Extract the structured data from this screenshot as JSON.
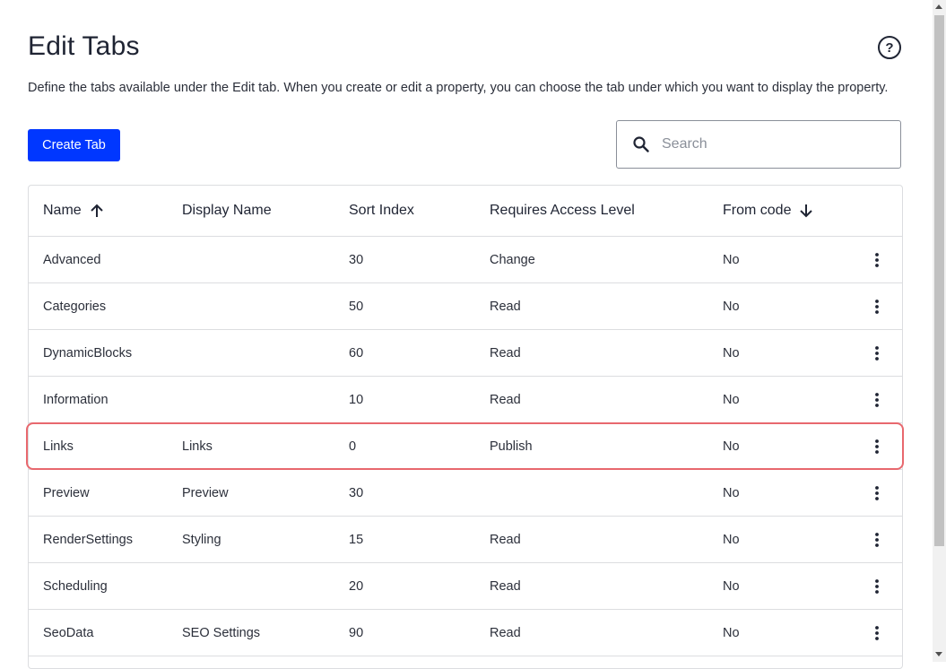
{
  "header": {
    "title": "Edit Tabs",
    "help_icon": "question-circle-icon",
    "description": "Define the tabs available under the Edit tab. When you create or edit a property, you can choose the tab under which you want to display the property."
  },
  "toolbar": {
    "create_label": "Create Tab",
    "search_placeholder": "Search",
    "search_value": ""
  },
  "table": {
    "columns": {
      "name": "Name",
      "display_name": "Display Name",
      "sort_index": "Sort Index",
      "access_level": "Requires Access Level",
      "from_code": "From code"
    },
    "sort": {
      "name": "ascending",
      "from_code": "descending"
    },
    "rows": [
      {
        "name": "Advanced",
        "display_name": "",
        "sort_index": "30",
        "access_level": "Change",
        "from_code": "No"
      },
      {
        "name": "Categories",
        "display_name": "",
        "sort_index": "50",
        "access_level": "Read",
        "from_code": "No"
      },
      {
        "name": "DynamicBlocks",
        "display_name": "",
        "sort_index": "60",
        "access_level": "Read",
        "from_code": "No"
      },
      {
        "name": "Information",
        "display_name": "",
        "sort_index": "10",
        "access_level": "Read",
        "from_code": "No"
      },
      {
        "name": "Links",
        "display_name": "Links",
        "sort_index": "0",
        "access_level": "Publish",
        "from_code": "No",
        "highlighted": true
      },
      {
        "name": "Preview",
        "display_name": "Preview",
        "sort_index": "30",
        "access_level": "",
        "from_code": "No"
      },
      {
        "name": "RenderSettings",
        "display_name": "Styling",
        "sort_index": "15",
        "access_level": "Read",
        "from_code": "No"
      },
      {
        "name": "Scheduling",
        "display_name": "",
        "sort_index": "20",
        "access_level": "Read",
        "from_code": "No"
      },
      {
        "name": "SeoData",
        "display_name": "SEO Settings",
        "sort_index": "90",
        "access_level": "Read",
        "from_code": "No"
      }
    ]
  },
  "colors": {
    "primary": "#0037ff",
    "highlight": "#e8686e",
    "border": "#dcdde0",
    "text": "#1f2433"
  }
}
